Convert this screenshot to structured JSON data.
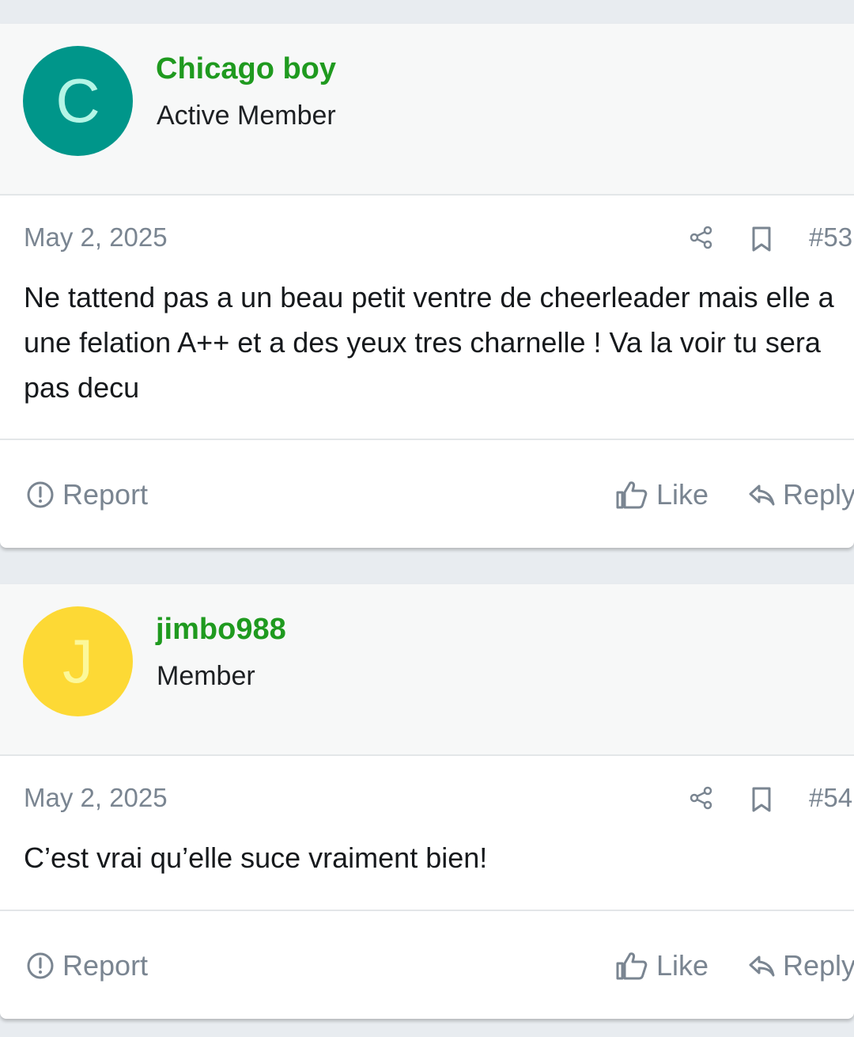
{
  "colors": {
    "username": "#1f9a1f",
    "muted": "#7a8591",
    "page_bg": "#e8ecf0",
    "header_bg": "#f7f8f8"
  },
  "posts": [
    {
      "avatar_letter": "C",
      "avatar_bg": "#00968a",
      "avatar_fg": "#b4f5e6",
      "username": "Chicago boy",
      "user_title": "Active Member",
      "date": "May 2, 2025",
      "post_number": "#53",
      "message": "Ne tattend pas a un beau petit ventre de cheerleader mais elle a une felation A++ et a des yeux tres charnelle ! Va la voir tu sera pas decu",
      "report_label": "Report",
      "like_label": "Like",
      "reply_label": "Reply"
    },
    {
      "avatar_letter": "J",
      "avatar_bg": "#fdd935",
      "avatar_fg": "#fcf89a",
      "username": "jimbo988",
      "user_title": "Member",
      "date": "May 2, 2025",
      "post_number": "#54",
      "message": "C’est vrai qu’elle suce vraiment bien!",
      "report_label": "Report",
      "like_label": "Like",
      "reply_label": "Reply"
    }
  ],
  "icons": {
    "share": "share-icon",
    "bookmark": "bookmark-icon",
    "report": "alert-circle-icon",
    "like": "thumbs-up-icon",
    "reply": "reply-arrow-icon"
  }
}
